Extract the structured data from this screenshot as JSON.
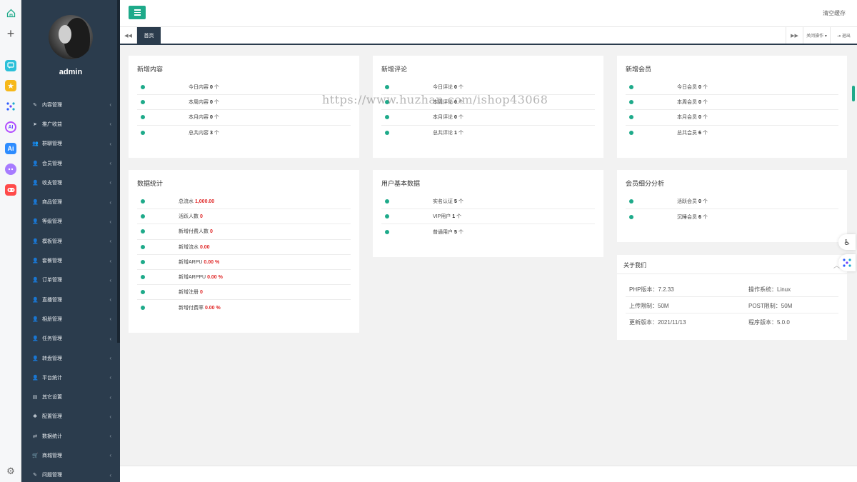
{
  "dock": {
    "plus": "+",
    "app2_glyph": "★",
    "app4_text": "AI",
    "app5_text": "Ai",
    "gear": "⚙"
  },
  "sidebar": {
    "username": "admin",
    "items": [
      {
        "icon": "✎",
        "label": "内容管理"
      },
      {
        "icon": "➤",
        "label": "推广收益"
      },
      {
        "icon": "👥",
        "label": "群聊管理"
      },
      {
        "icon": "👤",
        "label": "会员管理"
      },
      {
        "icon": "👤",
        "label": "收支管理"
      },
      {
        "icon": "👤",
        "label": "商品管理"
      },
      {
        "icon": "👤",
        "label": "等级管理"
      },
      {
        "icon": "👤",
        "label": "模板管理"
      },
      {
        "icon": "👤",
        "label": "套餐管理"
      },
      {
        "icon": "👤",
        "label": "订单管理"
      },
      {
        "icon": "👤",
        "label": "直播管理"
      },
      {
        "icon": "👤",
        "label": "相册管理"
      },
      {
        "icon": "👤",
        "label": "任务管理"
      },
      {
        "icon": "👤",
        "label": "转盘管理"
      },
      {
        "icon": "👤",
        "label": "平台统计"
      },
      {
        "icon": "▤",
        "label": "其它设置"
      },
      {
        "icon": "✱",
        "label": "配置管理"
      },
      {
        "icon": "⇄",
        "label": "数据统计"
      },
      {
        "icon": "🛒",
        "label": "商城管理"
      },
      {
        "icon": "✎",
        "label": "问题管理"
      }
    ],
    "arrow": "‹"
  },
  "topbar": {
    "clear_cache": "清空缓存"
  },
  "tabs": {
    "prev": "◀◀",
    "home": "首页",
    "next": "▶▶",
    "close_ops": "关闭操作 ▾",
    "logout": "⇥ 退出"
  },
  "cards": {
    "content": {
      "title": "新增内容",
      "rows": [
        {
          "label": "今日内容",
          "value": "0",
          "unit": "个"
        },
        {
          "label": "本周内容",
          "value": "0",
          "unit": "个"
        },
        {
          "label": "本月内容",
          "value": "0",
          "unit": "个"
        },
        {
          "label": "总共内容",
          "value": "3",
          "unit": "个"
        }
      ]
    },
    "comments": {
      "title": "新增评论",
      "rows": [
        {
          "label": "今日评论",
          "value": "0",
          "unit": "个"
        },
        {
          "label": "本周评论",
          "value": "0",
          "unit": "个"
        },
        {
          "label": "本月评论",
          "value": "0",
          "unit": "个"
        },
        {
          "label": "总共评论",
          "value": "1",
          "unit": "个"
        }
      ]
    },
    "members": {
      "title": "新增会员",
      "rows": [
        {
          "label": "今日会员",
          "value": "0",
          "unit": "个"
        },
        {
          "label": "本周会员",
          "value": "0",
          "unit": "个"
        },
        {
          "label": "本月会员",
          "value": "0",
          "unit": "个"
        },
        {
          "label": "总共会员",
          "value": "6",
          "unit": "个"
        }
      ]
    },
    "stats": {
      "title": "数据统计",
      "rows": [
        {
          "label": "总流水",
          "value": "1,000.00",
          "unit": ""
        },
        {
          "label": "活跃人数",
          "value": "0",
          "unit": ""
        },
        {
          "label": "新增付费人数",
          "value": "0",
          "unit": ""
        },
        {
          "label": "新增流水",
          "value": "0.00",
          "unit": ""
        },
        {
          "label": "新增ARPU",
          "value": "0.00 %",
          "unit": ""
        },
        {
          "label": "新增ARPPU",
          "value": "0.00 %",
          "unit": ""
        },
        {
          "label": "新增注册",
          "value": "0",
          "unit": ""
        },
        {
          "label": "新增付费率",
          "value": "0.00 %",
          "unit": ""
        }
      ]
    },
    "user_basic": {
      "title": "用户基本数据",
      "rows": [
        {
          "label": "实名认证",
          "value": "5",
          "unit": "个"
        },
        {
          "label": "VIP用户",
          "value": "1",
          "unit": "个"
        },
        {
          "label": "普通用户",
          "value": "5",
          "unit": "个"
        }
      ]
    },
    "member_analysis": {
      "title": "会员细分分析",
      "rows": [
        {
          "label": "活跃会员",
          "value": "0",
          "unit": "个"
        },
        {
          "label": "沉睡会员",
          "value": "6",
          "unit": "个"
        }
      ]
    },
    "about": {
      "title": "关于我们",
      "chevron": "︿",
      "rows": [
        [
          "PHP版本：7.2.33",
          "操作系统：Linux"
        ],
        [
          "上传限制：50M",
          "POST限制：50M"
        ],
        [
          "更新版本：2021/11/13",
          "程序版本：5.0.0"
        ]
      ]
    }
  },
  "floating": {
    "a11y_glyph": "♿"
  },
  "watermark": "https://www.huzhan.com/ishop43068",
  "colors": {
    "accent": "#1eaa8a",
    "sidebar_bg": "#2b3c4d",
    "highlight_red": "#e02828",
    "page_bg": "#f2f2f2"
  }
}
